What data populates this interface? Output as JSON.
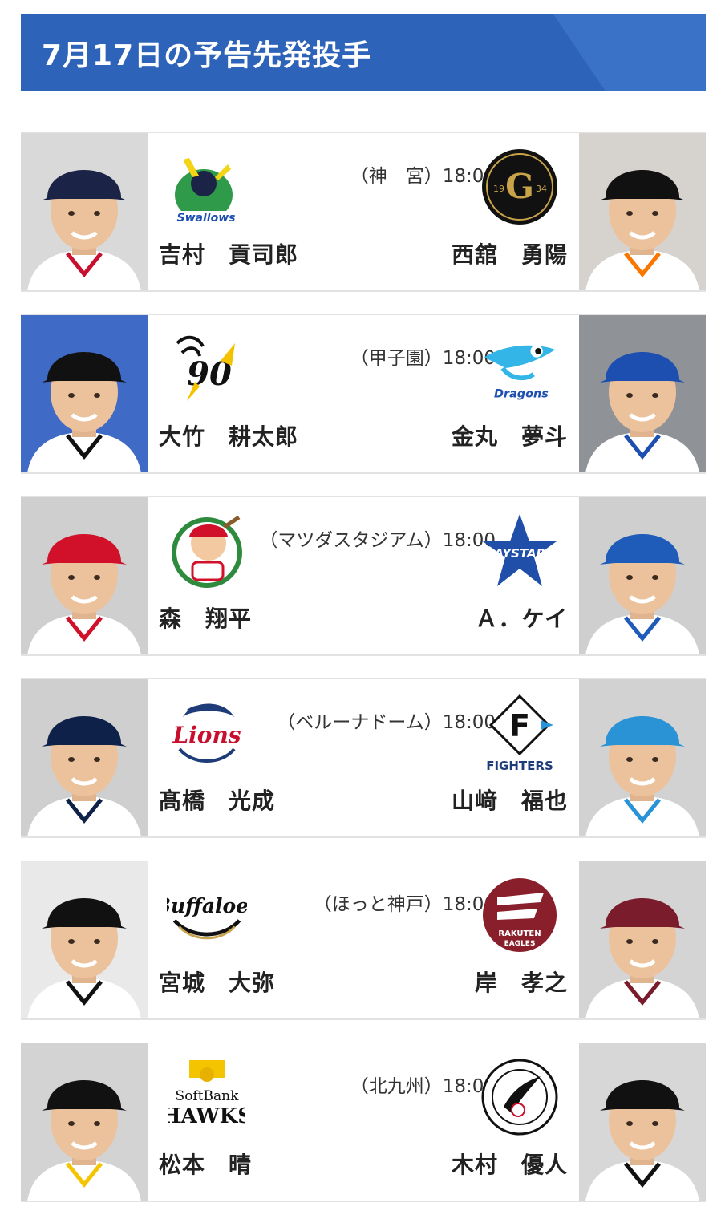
{
  "header": {
    "title": "7月17日の予告先発投手"
  },
  "games": [
    {
      "venue_time": "（神　宮）18:00",
      "home": {
        "team_logo": "swallows-logo",
        "name": "吉村　貢司郎",
        "photo": "pitcher-photo",
        "bg": "#d9d9d9",
        "cap": "#1b2447",
        "jersey": "#ffffff",
        "trim": "#c8102e"
      },
      "away": {
        "team_logo": "giants-logo",
        "name": "西舘　勇陽",
        "photo": "pitcher-photo",
        "bg": "#d6d3cf",
        "cap": "#111111",
        "jersey": "#ffffff",
        "trim": "#f97600"
      }
    },
    {
      "venue_time": "（甲子園）18:00",
      "home": {
        "team_logo": "tigers-90th-logo",
        "name": "大竹　耕太郎",
        "photo": "pitcher-photo",
        "bg": "#3f6ac6",
        "cap": "#111111",
        "jersey": "#ffffff",
        "trim": "#111111"
      },
      "away": {
        "team_logo": "dragons-logo",
        "name": "金丸　夢斗",
        "photo": "pitcher-photo",
        "bg": "#8f9398",
        "cap": "#1d4fb0",
        "jersey": "#ffffff",
        "trim": "#1d4fb0"
      }
    },
    {
      "venue_time": "（マツダスタジアム）18:00",
      "home": {
        "team_logo": "carp-logo",
        "name": "森　翔平",
        "photo": "pitcher-photo",
        "bg": "#cfcfcf",
        "cap": "#d1102a",
        "jersey": "#ffffff",
        "trim": "#d1102a"
      },
      "away": {
        "team_logo": "baystars-logo",
        "name": "Ａ．ケイ",
        "photo": "pitcher-photo",
        "bg": "#cfcfcf",
        "cap": "#1f5bb8",
        "jersey": "#ffffff",
        "trim": "#1f5bb8"
      }
    },
    {
      "venue_time": "（ベルーナドーム）18:00",
      "home": {
        "team_logo": "lions-logo",
        "name": "髙橋　光成",
        "photo": "pitcher-photo",
        "bg": "#cfcfcf",
        "cap": "#0e2148",
        "jersey": "#ffffff",
        "trim": "#0e2148"
      },
      "away": {
        "team_logo": "fighters-logo",
        "name": "山﨑　福也",
        "photo": "pitcher-photo",
        "bg": "#d2d2d2",
        "cap": "#2a93d6",
        "jersey": "#ffffff",
        "trim": "#2a93d6"
      }
    },
    {
      "venue_time": "（ほっと神戸）18:00",
      "home": {
        "team_logo": "buffaloes-logo",
        "name": "宮城　大弥",
        "photo": "pitcher-photo",
        "bg": "#e9e9e9",
        "cap": "#111111",
        "jersey": "#ffffff",
        "trim": "#111111"
      },
      "away": {
        "team_logo": "eagles-logo",
        "name": "岸　孝之",
        "photo": "pitcher-photo",
        "bg": "#d4d4d4",
        "cap": "#7a1c2c",
        "jersey": "#ffffff",
        "trim": "#7a1c2c"
      }
    },
    {
      "venue_time": "（北九州）18:00",
      "home": {
        "team_logo": "hawks-logo",
        "name": "松本　晴",
        "photo": "pitcher-photo",
        "bg": "#d3d3d3",
        "cap": "#111111",
        "jersey": "#ffffff",
        "trim": "#f5c400"
      },
      "away": {
        "team_logo": "marines-logo",
        "name": "木村　優人",
        "photo": "pitcher-photo",
        "bg": "#d7d7d7",
        "cap": "#111111",
        "jersey": "#ffffff",
        "trim": "#111111"
      }
    }
  ],
  "colors": {
    "banner": "#2d63b8",
    "banner_stripe": "#3a72c7",
    "divider": "#e2e2e2"
  }
}
